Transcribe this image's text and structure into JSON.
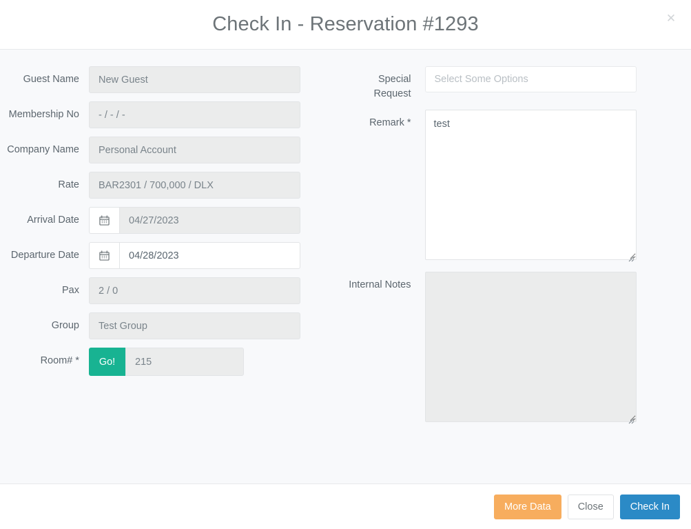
{
  "header": {
    "title": "Check In - Reservation #1293",
    "close_icon": "close-icon"
  },
  "form": {
    "left": [
      {
        "label": "Guest Name",
        "value": "New Guest",
        "type": "text",
        "disabled": true
      },
      {
        "label": "Membership No",
        "value": "- / - /  -",
        "type": "text",
        "disabled": true
      },
      {
        "label": "Company Name",
        "value": "Personal Account",
        "type": "text",
        "disabled": true
      },
      {
        "label": "Rate",
        "value": "BAR2301 / 700,000 / DLX",
        "type": "text",
        "disabled": true
      },
      {
        "label": "Arrival Date",
        "value": "04/27/2023",
        "type": "date",
        "disabled": true,
        "icon": "calendar-icon"
      },
      {
        "label": "Departure Date",
        "value": "04/28/2023",
        "type": "date",
        "disabled": false,
        "icon": "calendar-icon"
      },
      {
        "label": "Pax",
        "value": "2 / 0",
        "type": "text",
        "disabled": true
      },
      {
        "label": "Group",
        "value": "Test Group",
        "type": "text",
        "disabled": true
      },
      {
        "label": "Room# *",
        "value": "215",
        "type": "go",
        "disabled": true,
        "button_label": "Go!"
      }
    ],
    "right": [
      {
        "label": "Special Request",
        "value": "",
        "placeholder": "Select Some Options",
        "type": "multiselect",
        "disabled": false
      },
      {
        "label": "Remark *",
        "value": "test",
        "placeholder": "",
        "type": "textarea",
        "disabled": false
      },
      {
        "label": "Internal Notes",
        "value": "",
        "placeholder": "",
        "type": "textarea",
        "disabled": true
      }
    ]
  },
  "footer": {
    "more_data_label": "More Data",
    "close_label": "Close",
    "check_in_label": "Check In"
  },
  "colors": {
    "go_green": "#18b392",
    "more_data_orange": "#f7ad5e",
    "check_in_blue": "#2b8ac6",
    "body_bg": "#f8f9fb",
    "disabled_field": "#ebecec"
  }
}
